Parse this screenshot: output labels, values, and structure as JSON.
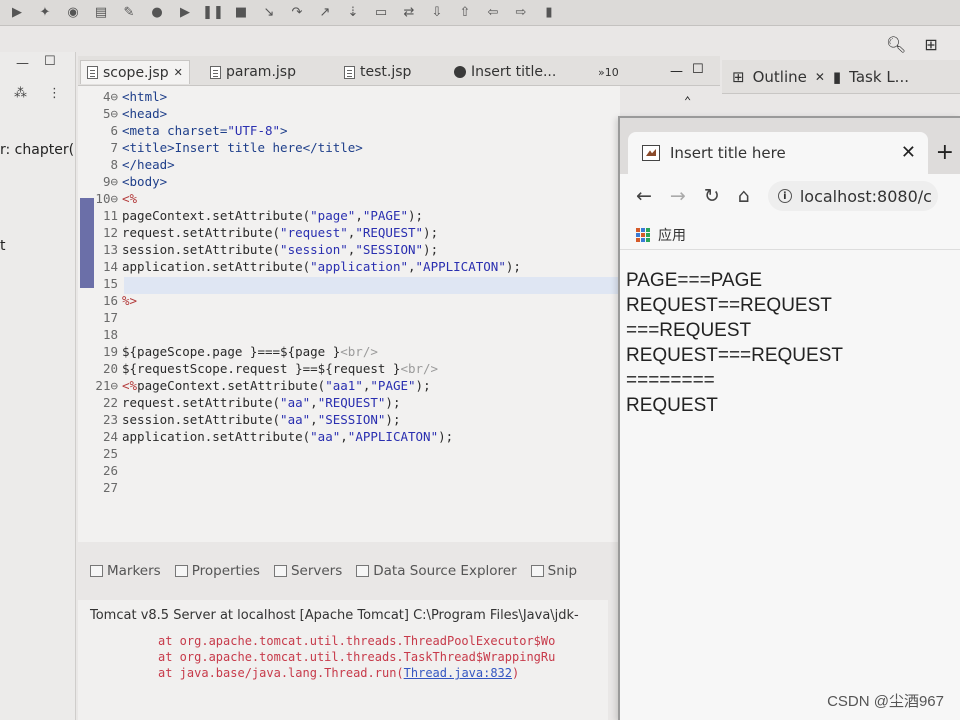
{
  "editor": {
    "tabs": [
      {
        "label": "scope.jsp",
        "close": "✕"
      },
      {
        "label": "param.jsp"
      },
      {
        "label": "test.jsp"
      },
      {
        "label": "Insert title..."
      },
      {
        "label": "»10"
      }
    ],
    "lines": [
      {
        "num": "4⊖",
        "text": "<html>"
      },
      {
        "num": "5⊖",
        "text": "<head>"
      },
      {
        "num": "6",
        "text": "<meta charset=\"UTF-8\">"
      },
      {
        "num": "7",
        "text": "<title>Insert title here</title>"
      },
      {
        "num": "8",
        "text": "</head>"
      },
      {
        "num": "9⊖",
        "text": "<body>"
      },
      {
        "num": "10⊖",
        "text": "<%"
      },
      {
        "num": "11",
        "text": "pageContext.setAttribute(\"page\",\"PAGE\");"
      },
      {
        "num": "12",
        "text": "request.setAttribute(\"request\",\"REQUEST\");"
      },
      {
        "num": "13",
        "text": "session.setAttribute(\"session\",\"SESSION\");"
      },
      {
        "num": "14",
        "text": "application.setAttribute(\"application\",\"APPLICATON\");"
      },
      {
        "num": "15",
        "text": ""
      },
      {
        "num": "16",
        "text": "%>"
      },
      {
        "num": "17",
        "text": ""
      },
      {
        "num": "18",
        "text": ""
      },
      {
        "num": "19",
        "text": "${pageScope.page }===${page }<br/>"
      },
      {
        "num": "20",
        "text": "${requestScope.request }==${request }<br/>"
      },
      {
        "num": "21⊖",
        "text": "<%pageContext.setAttribute(\"aa1\",\"PAGE\");"
      },
      {
        "num": "22",
        "text": "request.setAttribute(\"aa\",\"REQUEST\");"
      },
      {
        "num": "23",
        "text": "session.setAttribute(\"aa\",\"SESSION\");"
      },
      {
        "num": "24",
        "text": "application.setAttribute(\"aa\",\"APPLICATON\");"
      },
      {
        "num": "25",
        "text": ""
      },
      {
        "num": "26",
        "text": ""
      },
      {
        "num": "27",
        "text": ""
      }
    ]
  },
  "left_panel": {
    "label": "r: chapter(",
    "bang": "t"
  },
  "bottom": {
    "tabs": [
      "Markers",
      "Properties",
      "Servers",
      "Data Source Explorer",
      "Snip"
    ],
    "console_title": "Tomcat v8.5 Server at localhost [Apache Tomcat] C:\\Program Files\\Java\\jdk-",
    "errors": [
      {
        "text": "at org.apache.tomcat.util.threads.ThreadPoolExecutor$Wo",
        "link": ""
      },
      {
        "text": "at org.apache.tomcat.util.threads.TaskThread$WrappingRu",
        "link": ""
      },
      {
        "text": "at java.base/java.lang.Thread.run(",
        "link": "Thread.java:832",
        "suffix": ")"
      }
    ]
  },
  "outline": {
    "tab1": "Outline",
    "tab1_close": "✕",
    "tab2": "Task L..."
  },
  "browser": {
    "tab_title": "Insert title here",
    "close": "✕",
    "new_tab": "+",
    "address": "localhost:8080/c",
    "bookmark": "应用",
    "output": [
      "PAGE===PAGE",
      "REQUEST==REQUEST",
      "===REQUEST",
      "REQUEST===REQUEST",
      "========",
      "REQUEST"
    ]
  },
  "watermark": "CSDN @尘酒967",
  "icons": {
    "back": "back-arrow-icon",
    "forward": "forward-arrow-icon",
    "reload": "reload-icon",
    "home": "home-icon"
  }
}
